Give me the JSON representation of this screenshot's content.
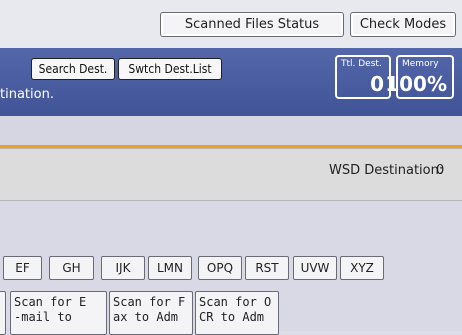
{
  "top_buttons": {
    "scanned_files_status": "Scanned Files Status",
    "check_modes": "Check Modes"
  },
  "header": {
    "search_dest": "Search Dest.",
    "switch_dest_list": "Swtch Dest.List",
    "instruction_fragment": "tination.",
    "total_dest": {
      "label": "Ttl. Dest.",
      "value": "0"
    },
    "memory": {
      "label": "Memory",
      "value": "100%"
    }
  },
  "wsd": {
    "label": "WSD Destination:",
    "value": "0"
  },
  "index_tabs": [
    "EF",
    "GH",
    "IJK",
    "LMN",
    "OPQ",
    "RST",
    "UVW",
    "XYZ"
  ],
  "destinations": [
    {
      "line1": "Scan for E",
      "line2": "-mail to "
    },
    {
      "line1": "Scan for F",
      "line2": "ax to Adm"
    },
    {
      "line1": "Scan for O",
      "line2": "CR to Adm"
    }
  ],
  "colors": {
    "header": "#4c60a4",
    "accent_line": "#f0a020",
    "background": "#dcdde6"
  }
}
